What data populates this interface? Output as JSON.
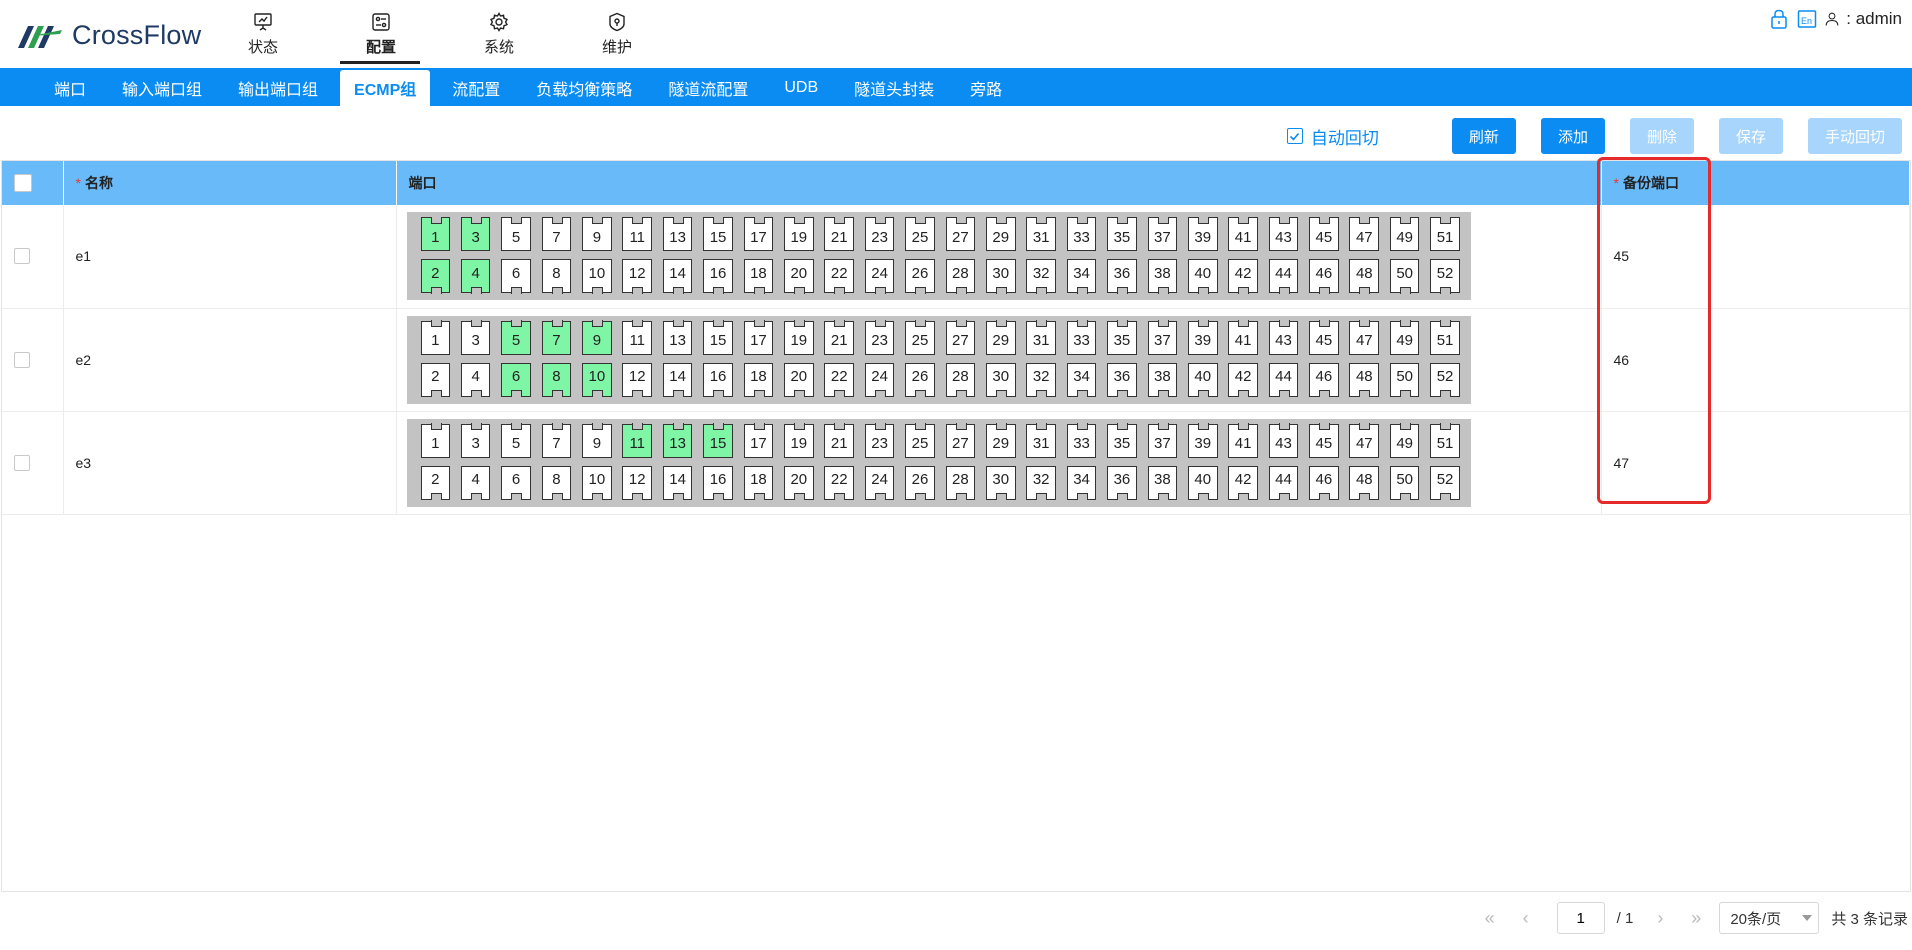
{
  "app": {
    "logo_text": "CrossFlow",
    "brand_color": "#0a8cf3"
  },
  "nav": [
    {
      "label": "状态",
      "icon": "presentation-icon",
      "active": false
    },
    {
      "label": "配置",
      "icon": "config-icon",
      "active": true
    },
    {
      "label": "系统",
      "icon": "gear-icon",
      "active": false
    },
    {
      "label": "维护",
      "icon": "maintenance-icon",
      "active": false
    }
  ],
  "user": {
    "name": ": admin",
    "icons": [
      "lock-icon",
      "language-icon",
      "user-icon"
    ],
    "language_label": "En"
  },
  "tabs": [
    {
      "label": "端口",
      "active": false
    },
    {
      "label": "输入端口组",
      "active": false
    },
    {
      "label": "输出端口组",
      "active": false
    },
    {
      "label": "ECMP组",
      "active": true
    },
    {
      "label": "流配置",
      "active": false
    },
    {
      "label": "负载均衡策略",
      "active": false
    },
    {
      "label": "隧道流配置",
      "active": false
    },
    {
      "label": "UDB",
      "active": false
    },
    {
      "label": "隧道头封装",
      "active": false
    },
    {
      "label": "旁路",
      "active": false
    }
  ],
  "toolbar": {
    "auto_switch_label": "自动回切",
    "auto_switch_checked": true,
    "refresh": "刷新",
    "add": "添加",
    "delete": "删除",
    "save": "保存",
    "manual_switch": "手动回切"
  },
  "table": {
    "columns": {
      "name": "名称",
      "ports": "端口",
      "backup": "备份端口"
    },
    "required_mark": "*",
    "top_ports": [
      "1",
      "3",
      "5",
      "7",
      "9",
      "11",
      "13",
      "15",
      "17",
      "19",
      "21",
      "23",
      "25",
      "27",
      "29",
      "31",
      "33",
      "35",
      "37",
      "39",
      "41",
      "43",
      "45",
      "47",
      "49",
      "51"
    ],
    "bottom_ports": [
      "2",
      "4",
      "6",
      "8",
      "10",
      "12",
      "14",
      "16",
      "18",
      "20",
      "22",
      "24",
      "26",
      "28",
      "30",
      "32",
      "34",
      "36",
      "38",
      "40",
      "42",
      "44",
      "46",
      "48",
      "50",
      "52"
    ],
    "rows": [
      {
        "name": "e1",
        "selected_ports": [
          "1",
          "2",
          "3",
          "4"
        ],
        "backup": "45"
      },
      {
        "name": "e2",
        "selected_ports": [
          "5",
          "6",
          "7",
          "8",
          "9",
          "10"
        ],
        "backup": "46"
      },
      {
        "name": "e3",
        "selected_ports": [
          "11",
          "13",
          "15"
        ],
        "backup": "47"
      }
    ],
    "selected_color": "#7ff5a6"
  },
  "pagination": {
    "first": "«",
    "prev": "‹",
    "next": "›",
    "last": "»",
    "current_page": "1",
    "total_pages": "/ 1",
    "page_size": "20条/页",
    "total_records": "共 3 条记录"
  }
}
